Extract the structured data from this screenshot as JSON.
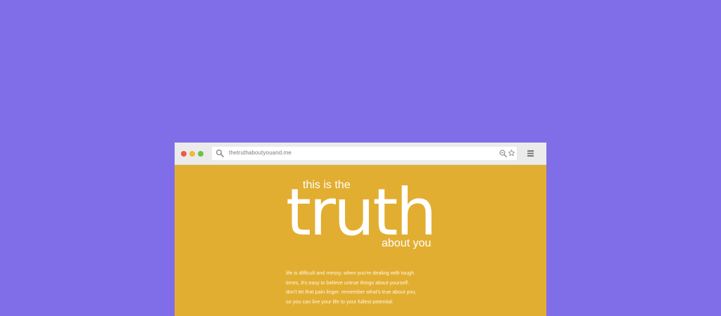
{
  "browser": {
    "url": "thetruthaboutyouand.me",
    "icons": {
      "traffic_lights": [
        "close-dot",
        "minimize-dot",
        "maximize-dot"
      ],
      "search": "search-icon",
      "zoom": "zoom-icon",
      "bookmark": "star-icon",
      "menu": "menu-icon"
    }
  },
  "page": {
    "kicker": "this is the",
    "headline": "truth",
    "subhead": "about you",
    "body_lines": [
      "life is difficult and messy. when you're dealing with tough",
      "times, it's easy to believe untrue things about yourself.",
      "don't let that pain linger. remember what's true about you,",
      "so you can live your life to your fullest potential."
    ]
  },
  "colors": {
    "background": "#806de8",
    "page_background": "#e2ae31",
    "chrome_background": "#ebebeb",
    "close": "#e85c4a",
    "minimize": "#f0b93a",
    "maximize": "#6cc24a",
    "text": "#ffffff"
  }
}
